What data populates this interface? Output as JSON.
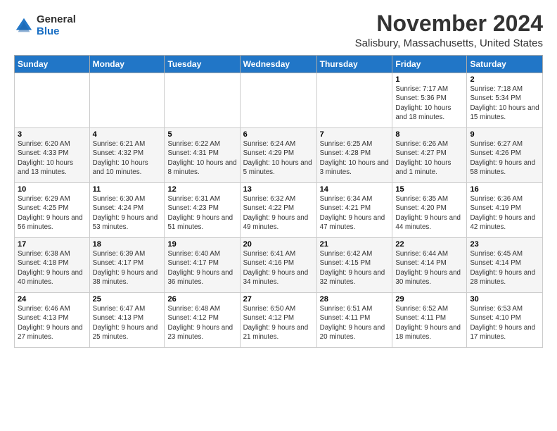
{
  "logo": {
    "general": "General",
    "blue": "Blue"
  },
  "title": "November 2024",
  "location": "Salisbury, Massachusetts, United States",
  "days_of_week": [
    "Sunday",
    "Monday",
    "Tuesday",
    "Wednesday",
    "Thursday",
    "Friday",
    "Saturday"
  ],
  "weeks": [
    [
      {
        "day": "",
        "info": ""
      },
      {
        "day": "",
        "info": ""
      },
      {
        "day": "",
        "info": ""
      },
      {
        "day": "",
        "info": ""
      },
      {
        "day": "",
        "info": ""
      },
      {
        "day": "1",
        "info": "Sunrise: 7:17 AM\nSunset: 5:36 PM\nDaylight: 10 hours and 18 minutes."
      },
      {
        "day": "2",
        "info": "Sunrise: 7:18 AM\nSunset: 5:34 PM\nDaylight: 10 hours and 15 minutes."
      }
    ],
    [
      {
        "day": "3",
        "info": "Sunrise: 6:20 AM\nSunset: 4:33 PM\nDaylight: 10 hours and 13 minutes."
      },
      {
        "day": "4",
        "info": "Sunrise: 6:21 AM\nSunset: 4:32 PM\nDaylight: 10 hours and 10 minutes."
      },
      {
        "day": "5",
        "info": "Sunrise: 6:22 AM\nSunset: 4:31 PM\nDaylight: 10 hours and 8 minutes."
      },
      {
        "day": "6",
        "info": "Sunrise: 6:24 AM\nSunset: 4:29 PM\nDaylight: 10 hours and 5 minutes."
      },
      {
        "day": "7",
        "info": "Sunrise: 6:25 AM\nSunset: 4:28 PM\nDaylight: 10 hours and 3 minutes."
      },
      {
        "day": "8",
        "info": "Sunrise: 6:26 AM\nSunset: 4:27 PM\nDaylight: 10 hours and 1 minute."
      },
      {
        "day": "9",
        "info": "Sunrise: 6:27 AM\nSunset: 4:26 PM\nDaylight: 9 hours and 58 minutes."
      }
    ],
    [
      {
        "day": "10",
        "info": "Sunrise: 6:29 AM\nSunset: 4:25 PM\nDaylight: 9 hours and 56 minutes."
      },
      {
        "day": "11",
        "info": "Sunrise: 6:30 AM\nSunset: 4:24 PM\nDaylight: 9 hours and 53 minutes."
      },
      {
        "day": "12",
        "info": "Sunrise: 6:31 AM\nSunset: 4:23 PM\nDaylight: 9 hours and 51 minutes."
      },
      {
        "day": "13",
        "info": "Sunrise: 6:32 AM\nSunset: 4:22 PM\nDaylight: 9 hours and 49 minutes."
      },
      {
        "day": "14",
        "info": "Sunrise: 6:34 AM\nSunset: 4:21 PM\nDaylight: 9 hours and 47 minutes."
      },
      {
        "day": "15",
        "info": "Sunrise: 6:35 AM\nSunset: 4:20 PM\nDaylight: 9 hours and 44 minutes."
      },
      {
        "day": "16",
        "info": "Sunrise: 6:36 AM\nSunset: 4:19 PM\nDaylight: 9 hours and 42 minutes."
      }
    ],
    [
      {
        "day": "17",
        "info": "Sunrise: 6:38 AM\nSunset: 4:18 PM\nDaylight: 9 hours and 40 minutes."
      },
      {
        "day": "18",
        "info": "Sunrise: 6:39 AM\nSunset: 4:17 PM\nDaylight: 9 hours and 38 minutes."
      },
      {
        "day": "19",
        "info": "Sunrise: 6:40 AM\nSunset: 4:17 PM\nDaylight: 9 hours and 36 minutes."
      },
      {
        "day": "20",
        "info": "Sunrise: 6:41 AM\nSunset: 4:16 PM\nDaylight: 9 hours and 34 minutes."
      },
      {
        "day": "21",
        "info": "Sunrise: 6:42 AM\nSunset: 4:15 PM\nDaylight: 9 hours and 32 minutes."
      },
      {
        "day": "22",
        "info": "Sunrise: 6:44 AM\nSunset: 4:14 PM\nDaylight: 9 hours and 30 minutes."
      },
      {
        "day": "23",
        "info": "Sunrise: 6:45 AM\nSunset: 4:14 PM\nDaylight: 9 hours and 28 minutes."
      }
    ],
    [
      {
        "day": "24",
        "info": "Sunrise: 6:46 AM\nSunset: 4:13 PM\nDaylight: 9 hours and 27 minutes."
      },
      {
        "day": "25",
        "info": "Sunrise: 6:47 AM\nSunset: 4:13 PM\nDaylight: 9 hours and 25 minutes."
      },
      {
        "day": "26",
        "info": "Sunrise: 6:48 AM\nSunset: 4:12 PM\nDaylight: 9 hours and 23 minutes."
      },
      {
        "day": "27",
        "info": "Sunrise: 6:50 AM\nSunset: 4:12 PM\nDaylight: 9 hours and 21 minutes."
      },
      {
        "day": "28",
        "info": "Sunrise: 6:51 AM\nSunset: 4:11 PM\nDaylight: 9 hours and 20 minutes."
      },
      {
        "day": "29",
        "info": "Sunrise: 6:52 AM\nSunset: 4:11 PM\nDaylight: 9 hours and 18 minutes."
      },
      {
        "day": "30",
        "info": "Sunrise: 6:53 AM\nSunset: 4:10 PM\nDaylight: 9 hours and 17 minutes."
      }
    ]
  ]
}
